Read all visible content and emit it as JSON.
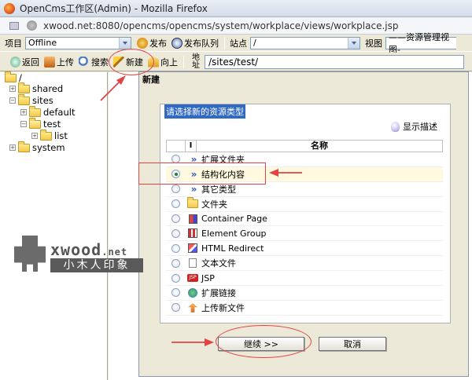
{
  "browser": {
    "title": "OpenCms工作区(Admin) - Mozilla Firefox",
    "url": "xwood.net:8080/opencms/opencms/system/workplace/views/workplace.jsp"
  },
  "toolbar1": {
    "project_label": "项目",
    "project_value": "Offline",
    "publish_label": "发布",
    "publish_queue_label": "发布队列",
    "site_label": "站点",
    "site_value": "/",
    "view_label": "视图",
    "view_value": "——资源管理视图-"
  },
  "toolbar2": {
    "back_label": "返回",
    "upload_label": "上传",
    "search_label": "搜索",
    "new_label": "新建",
    "up_label": "向上",
    "address_label": "地址",
    "address_value": "/sites/test/"
  },
  "tree": {
    "root": "/",
    "items": [
      "shared",
      "sites",
      "default",
      "test",
      "list",
      "system"
    ]
  },
  "dialog": {
    "title": "新建",
    "group_label": "请选择新的资源类型",
    "show_desc_label": "显示描述",
    "col_i": "I",
    "col_name": "名称",
    "rows": [
      {
        "label": "扩展文件夹",
        "icon": "chevron-icon"
      },
      {
        "label": "结构化内容",
        "icon": "chevron-icon"
      },
      {
        "label": "其它类型",
        "icon": "chevron-icon"
      },
      {
        "label": "文件夹",
        "icon": "folder-icon"
      },
      {
        "label": "Container Page",
        "icon": "container-page-icon"
      },
      {
        "label": "Element Group",
        "icon": "element-group-icon"
      },
      {
        "label": "HTML Redirect",
        "icon": "html-redirect-icon"
      },
      {
        "label": "文本文件",
        "icon": "text-file-icon"
      },
      {
        "label": "JSP",
        "icon": "jsp-icon"
      },
      {
        "label": "扩展链接",
        "icon": "link-icon"
      },
      {
        "label": "上传新文件",
        "icon": "upload-icon"
      }
    ],
    "selected_index": 1,
    "continue_label": "继续 >>",
    "cancel_label": "取消"
  },
  "watermark": {
    "brand": "xwood",
    "brand_suffix": ".net",
    "chinese": "小木人印象"
  },
  "colors": {
    "annotation": "#e04444",
    "legend_bg": "#3169c6"
  }
}
